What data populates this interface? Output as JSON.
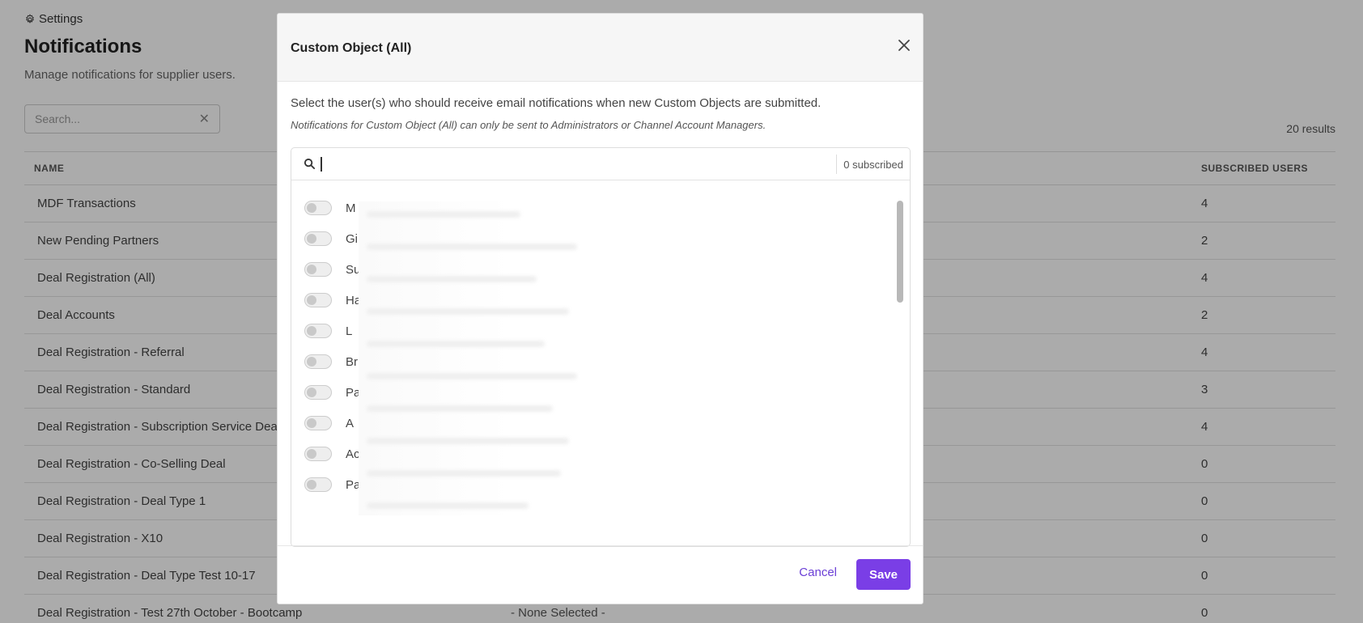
{
  "page": {
    "breadcrumb": "Settings",
    "title": "Notifications",
    "subtitle": "Manage notifications for supplier users.",
    "search_placeholder": "Search...",
    "results": "20 results",
    "columns": {
      "name": "NAME",
      "subscribed": "SUBSCRIBED USERS"
    },
    "rows": [
      {
        "name": "MDF Transactions",
        "mid": "",
        "subscribed": "4"
      },
      {
        "name": "New Pending Partners",
        "mid": "",
        "subscribed": "2"
      },
      {
        "name": "Deal Registration (All)",
        "mid": "",
        "subscribed": "4"
      },
      {
        "name": "Deal Accounts",
        "mid": "",
        "subscribed": "2"
      },
      {
        "name": "Deal Registration - Referral",
        "mid": "",
        "subscribed": "4"
      },
      {
        "name": "Deal Registration - Standard",
        "mid": "",
        "subscribed": "3"
      },
      {
        "name": "Deal Registration - Subscription Service Deal",
        "mid": "",
        "subscribed": "4"
      },
      {
        "name": "Deal Registration - Co-Selling Deal",
        "mid": "",
        "subscribed": "0"
      },
      {
        "name": "Deal Registration - Deal Type 1",
        "mid": "",
        "subscribed": "0"
      },
      {
        "name": "Deal Registration - X10",
        "mid": "",
        "subscribed": "0"
      },
      {
        "name": "Deal Registration - Deal Type Test 10-17",
        "mid": "",
        "subscribed": "0"
      },
      {
        "name": "Deal Registration - Test 27th October - Bootcamp",
        "mid": "- None Selected -",
        "subscribed": "0"
      }
    ]
  },
  "modal": {
    "title": "Custom Object (All)",
    "description": "Select the user(s) who should receive email notifications when new Custom Objects are submitted.",
    "note": "Notifications for Custom Object (All) can only be sent to Administrators or Channel Account Managers.",
    "search_value": "",
    "subscribed_count": "0 subscribed",
    "users": [
      {
        "initial": "M"
      },
      {
        "initial": "Gi"
      },
      {
        "initial": "Su"
      },
      {
        "initial": "Ha"
      },
      {
        "initial": "L"
      },
      {
        "initial": "Br"
      },
      {
        "initial": "Pa"
      },
      {
        "initial": "A"
      },
      {
        "initial": "Ac"
      },
      {
        "initial": "Pa"
      }
    ],
    "cancel_label": "Cancel",
    "save_label": "Save"
  },
  "colors": {
    "accent": "#7a3ee6",
    "link": "#6b3fd6"
  }
}
